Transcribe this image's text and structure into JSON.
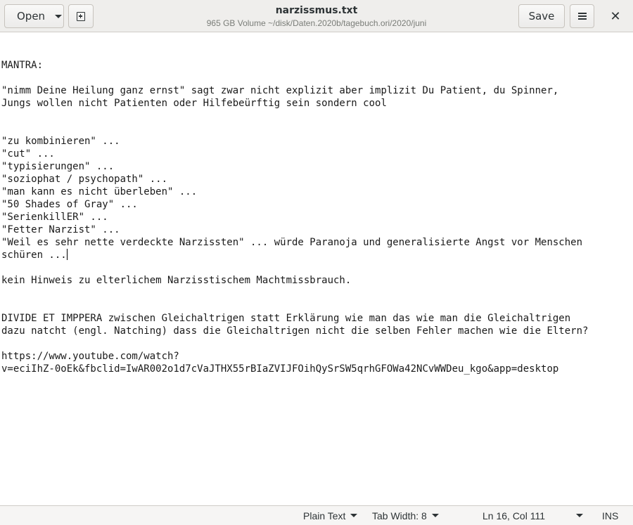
{
  "header": {
    "open_label": "Open",
    "save_label": "Save",
    "title": "narzissmus.txt",
    "subtitle": "965 GB Volume ~/disk/Daten.2020b/tagebuch.ori/2020/juni",
    "icons": {
      "new_document": "new-document-icon",
      "menu": "hamburger-menu-icon",
      "close": "close-icon"
    }
  },
  "editor": {
    "lines": {
      "l01": "MANTRA:",
      "l02": "\"nimm Deine Heilung ganz ernst\" sagt zwar nicht explizit aber implizit Du Patient, du Spinner,",
      "l03": "Jungs wollen nicht Patienten oder Hilfebeürftig sein sondern cool",
      "l04": "\"zu kombinieren\" ...",
      "l05": "\"cut\" ...",
      "l06": "\"typisierungen\" ...",
      "l07": "\"soziophat / psychopath\" ...",
      "l08": "\"man kann es nicht überleben\" ...",
      "l09": "\"50 Shades of Gray\" ...",
      "l10": "\"SerienkillER\" ...",
      "l11": "\"Fetter Narzist\" ...",
      "l12": "\"Weil es sehr nette verdeckte Narzissten\" ... würde Paranoja und generalisierte Angst vor Menschen",
      "l13": "schüren ...",
      "l14": "kein Hinweis zu elterlichem Narzisstischem Machtmissbrauch.",
      "l15": "DIVIDE ET IMPPERA zwischen Gleichaltrigen statt Erklärung wie man das wie man die Gleichaltrigen",
      "l16": "dazu natcht (engl. Natching) dass die Gleichaltrigen nicht die selben Fehler machen wie die Eltern?",
      "l17": "https://www.youtube.com/watch?",
      "l18": "v=eciIhZ-0oEk&fbclid=IwAR002o1d7cVaJTHX55rBIaZVIJFOihQySrSW5qrhGFOWa42NCvWWDeu_kgo&app=desktop"
    }
  },
  "statusbar": {
    "language": "Plain Text",
    "tab_width": "Tab Width: 8",
    "position": "Ln 16, Col 111",
    "mode": "INS"
  }
}
